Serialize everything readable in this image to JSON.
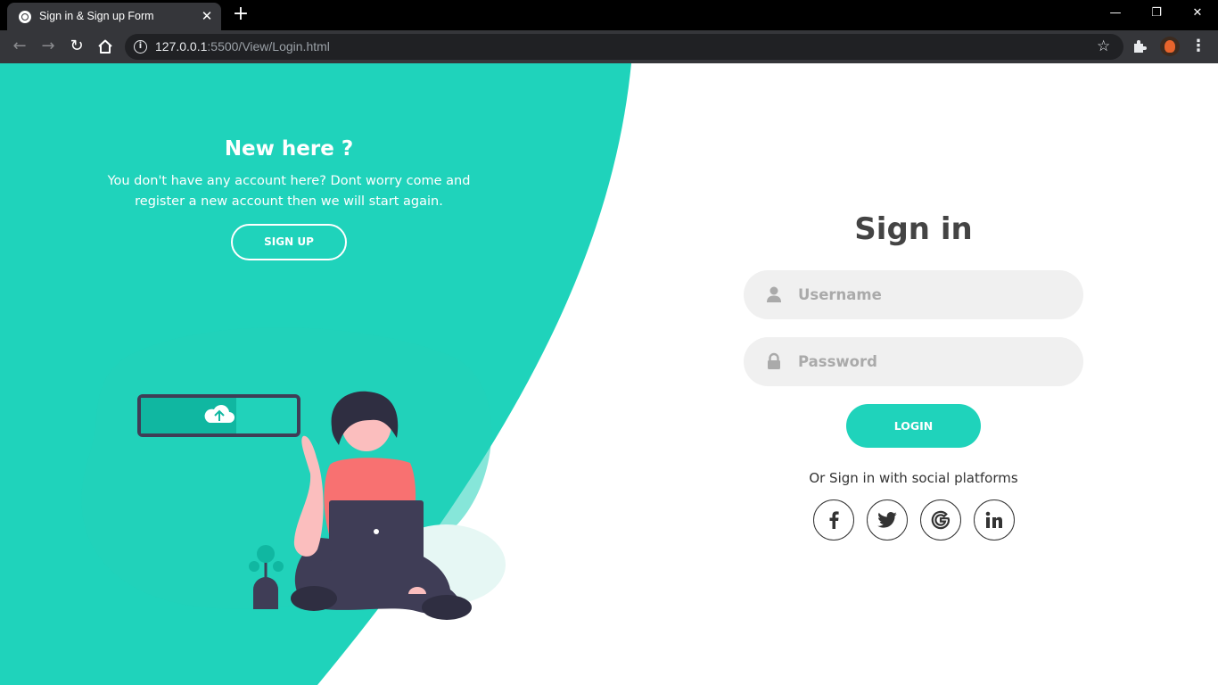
{
  "browser": {
    "tab_title": "Sign in & Sign up Form",
    "url_host": "127.0.0.1",
    "url_path": ":5500/View/Login.html",
    "tab_close": "✕",
    "new_tab": "+",
    "window_min": "—",
    "window_max": "❐",
    "window_close": "✕"
  },
  "left_panel": {
    "title": "New here ?",
    "text": "You don't have any account here? Dont worry come and register a new account then we will start again.",
    "signup_label": "SIGN UP"
  },
  "signin": {
    "title": "Sign in",
    "username_placeholder": "Username",
    "password_placeholder": "Password",
    "login_label": "LOGIN",
    "social_text": "Or Sign in with social platforms",
    "social_icons": [
      "facebook-icon",
      "twitter-icon",
      "google-icon",
      "linkedin-icon"
    ]
  },
  "colors": {
    "accent": "#1fd3bb",
    "text_dark": "#444444",
    "input_bg": "#f0f0f0",
    "browser_tab": "#35363a"
  }
}
